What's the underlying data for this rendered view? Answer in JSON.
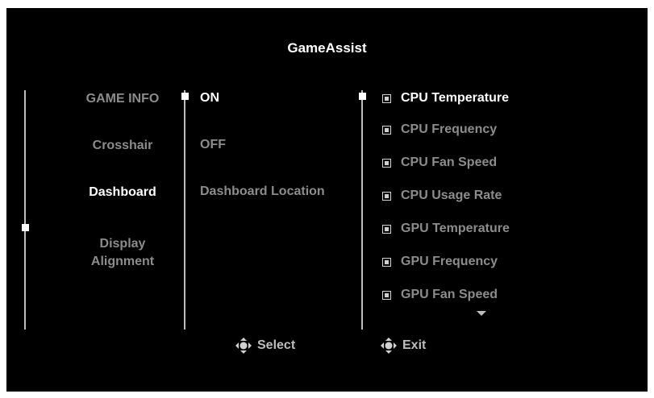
{
  "title": "GameAssist",
  "menu": {
    "items": [
      {
        "label": "GAME INFO"
      },
      {
        "label": "Crosshair"
      },
      {
        "label": "Dashboard"
      },
      {
        "label": "Display"
      },
      {
        "label": "Alignment"
      }
    ]
  },
  "submenu": {
    "items": [
      {
        "label": "ON"
      },
      {
        "label": "OFF"
      },
      {
        "label": "Dashboard Location"
      }
    ]
  },
  "options": {
    "items": [
      {
        "label": "CPU Temperature"
      },
      {
        "label": "CPU Frequency"
      },
      {
        "label": "CPU Fan Speed"
      },
      {
        "label": "CPU Usage Rate"
      },
      {
        "label": "GPU Temperature"
      },
      {
        "label": "GPU Frequency"
      },
      {
        "label": "GPU Fan Speed"
      }
    ]
  },
  "footer": {
    "select_label": "Select",
    "exit_label": "Exit"
  },
  "icons": {
    "nav": "navigation-joystick-icon",
    "checkbox": "checkbox-icon",
    "more": "chevron-down-icon"
  },
  "colors": {
    "background": "#000000",
    "active_text": "#ffffff",
    "inactive_text": "#8c8c8c"
  }
}
